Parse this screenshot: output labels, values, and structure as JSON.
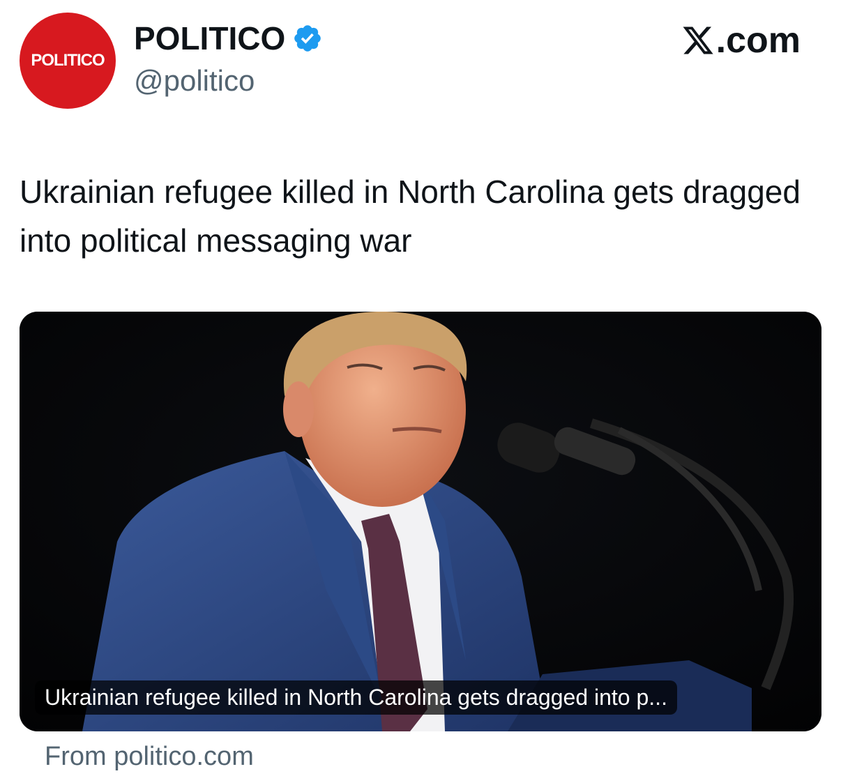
{
  "account": {
    "avatar_text": "POLITICO",
    "display_name": "POLITICO",
    "handle": "@politico",
    "verified_icon": "verified-badge-icon",
    "brand_color": "#d7191f",
    "verified_color": "#1d9bf0"
  },
  "site": {
    "logo_icon": "x-logo-icon",
    "label": ".com"
  },
  "tweet": {
    "text": "Ukrainian refugee killed in North Carolina gets dragged into political messaging war"
  },
  "card": {
    "caption": "Ukrainian refugee killed in North Carolina gets dragged into p...",
    "source": "From politico.com"
  }
}
